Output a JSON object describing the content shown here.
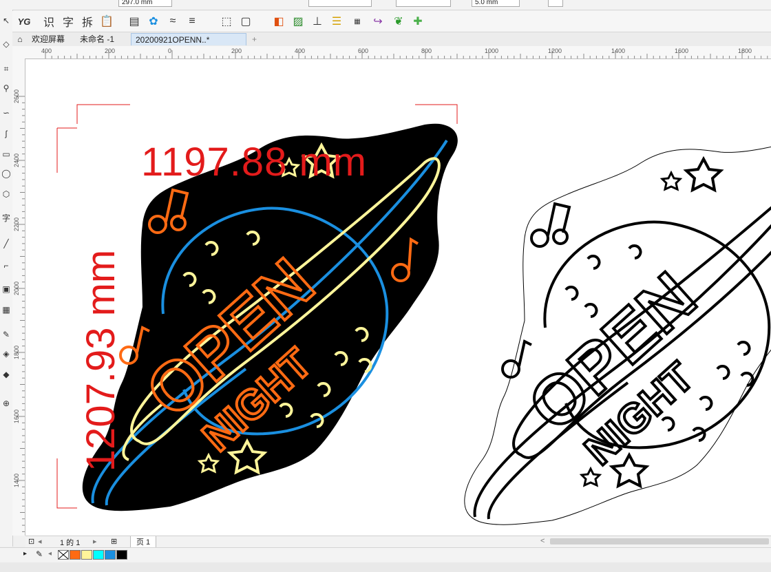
{
  "property_bar": {
    "page_height": "297.0 mm",
    "nudge": "5.0 mm"
  },
  "toolbar": {
    "icons": [
      "yg-icon",
      "recognize-icon",
      "text-icon",
      "split-icon",
      "clipboard-icon",
      "table-icon",
      "flower-icon",
      "wave-icon",
      "lines-icon",
      "select-icon",
      "color-icon",
      "image-icon",
      "align-icon",
      "list-icon",
      "dots-icon",
      "link-icon",
      "leaf-icon",
      "puzzle-icon"
    ],
    "labels": {
      "recognize": "识",
      "text": "字",
      "split": "拆",
      "yg": "YG"
    }
  },
  "tabs": {
    "home_label": "欢迎屏幕",
    "untitled_label": "未命名 -1",
    "doc_label": "20200921OPENN..*",
    "add_label": "+"
  },
  "rulers": {
    "h_ticks": [
      "400",
      "200",
      "0",
      "200",
      "400",
      "600",
      "800",
      "1000",
      "1200",
      "1400",
      "1600",
      "1800"
    ],
    "v_ticks": [
      "2600",
      "2400",
      "2200",
      "2000",
      "1800",
      "1600",
      "1400"
    ]
  },
  "dimensions": {
    "width_label": "1197.88 mm",
    "height_label": "1207.93 mm"
  },
  "design": {
    "main_text": "OPEN",
    "sub_text": "NIGHT",
    "colors": {
      "background": "#000000",
      "orange": "#ff6a13",
      "yellow": "#fff59a",
      "blue": "#1a8fe0",
      "dimension": "#e31b1b"
    }
  },
  "status": {
    "page_counter": "1 的 1",
    "page_tab": "页 1"
  },
  "palette": {
    "colors": [
      "none",
      "#ff6a13",
      "#fff59a",
      "#00ffff",
      "#1a8fe0",
      "#000000"
    ]
  }
}
